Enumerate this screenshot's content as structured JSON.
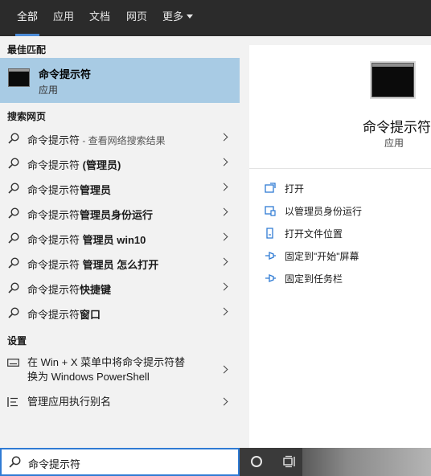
{
  "tabs": [
    {
      "label": "全部",
      "active": true
    },
    {
      "label": "应用",
      "active": false
    },
    {
      "label": "文档",
      "active": false
    },
    {
      "label": "网页",
      "active": false
    },
    {
      "label": "更多",
      "active": false
    }
  ],
  "best_match": {
    "header": "最佳匹配",
    "title": "命令提示符",
    "subtitle": "应用",
    "icon": "command-prompt-icon"
  },
  "web_search": {
    "header": "搜索网页",
    "items": [
      {
        "base": "命令提示符",
        "bold": "",
        "hint": " - 查看网络搜索结果"
      },
      {
        "base": "命令提示符 ",
        "bold": "(管理员)",
        "hint": ""
      },
      {
        "base": "命令提示符",
        "bold": "管理员",
        "hint": ""
      },
      {
        "base": "命令提示符",
        "bold": "管理员身份运行",
        "hint": ""
      },
      {
        "base": "命令提示符 ",
        "bold": "管理员 win10",
        "hint": ""
      },
      {
        "base": "命令提示符 ",
        "bold": "管理员 怎么打开",
        "hint": ""
      },
      {
        "base": "命令提示符",
        "bold": "快捷键",
        "hint": ""
      },
      {
        "base": "命令提示符",
        "bold": "窗口",
        "hint": ""
      }
    ]
  },
  "settings": {
    "header": "设置",
    "items": [
      {
        "line1": "在 Win + X 菜单中将命令提示符替",
        "line2": "换为 Windows PowerShell",
        "icon": "keyboard-icon"
      },
      {
        "line1": "管理应用执行别名",
        "line2": "",
        "icon": "list-settings-icon"
      }
    ]
  },
  "detail": {
    "title": "命令提示符",
    "type": "应用",
    "actions": [
      {
        "label": "打开",
        "icon": "open-icon"
      },
      {
        "label": "以管理员身份运行",
        "icon": "run-as-admin-icon"
      },
      {
        "label": "打开文件位置",
        "icon": "file-location-icon"
      },
      {
        "label": "固定到\"开始\"屏幕",
        "icon": "pin-icon"
      },
      {
        "label": "固定到任务栏",
        "icon": "pin-icon"
      }
    ]
  },
  "search": {
    "query": "命令提示符"
  },
  "colors": {
    "accent": "#2f7bd4",
    "selection": "#a8cbe4",
    "topbar": "#2b2b2b"
  }
}
